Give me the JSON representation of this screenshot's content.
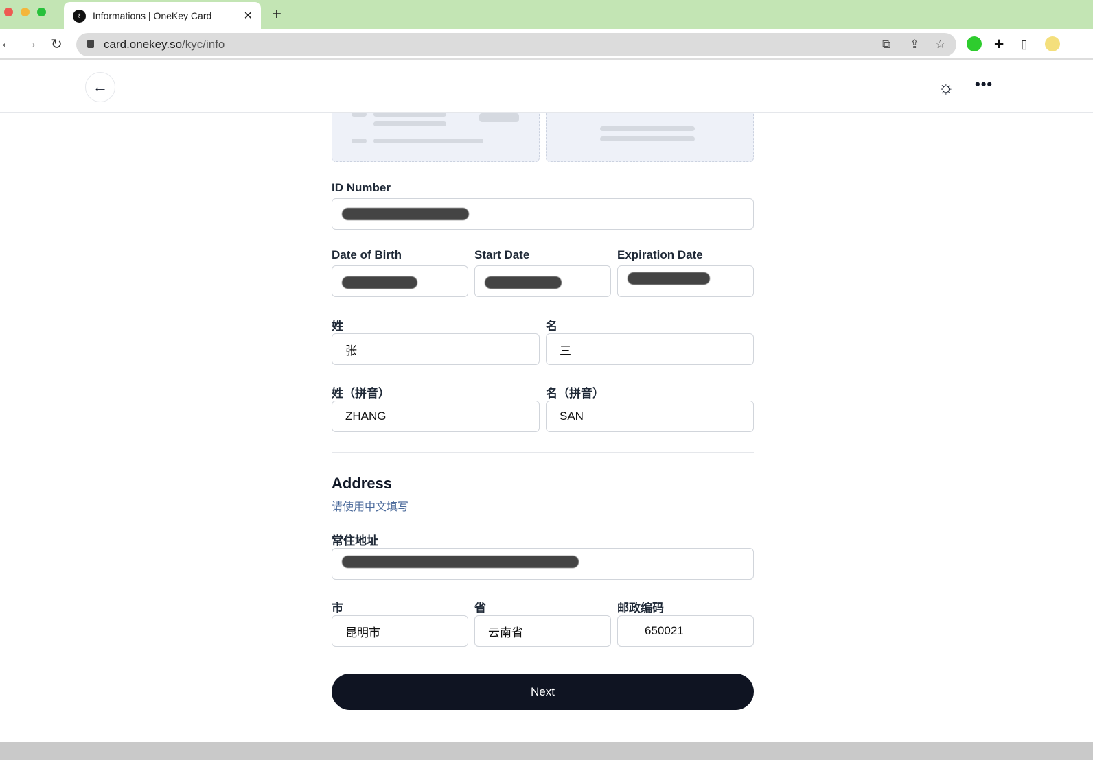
{
  "browser": {
    "tab_title": "Informations | OneKey Card",
    "url_host": "card.onekey.so",
    "url_path": "/kyc/info"
  },
  "form": {
    "id_number_label": "ID Number",
    "dob_label": "Date of Birth",
    "start_label": "Start Date",
    "expiration_label": "Expiration Date",
    "surname_label": "姓",
    "given_label": "名",
    "surname_value": "张",
    "given_value": "三",
    "surname_pinyin_label": "姓（拼音）",
    "given_pinyin_label": "名（拼音）",
    "surname_pinyin_value": "ZHANG",
    "given_pinyin_value": "SAN",
    "address_title": "Address",
    "address_hint": "请使用中文填写",
    "residence_label": "常住地址",
    "city_label": "市",
    "city_value": "昆明市",
    "province_label": "省",
    "province_value": "云南省",
    "postal_label": "邮政编码",
    "postal_value": "650021",
    "next_label": "Next"
  }
}
